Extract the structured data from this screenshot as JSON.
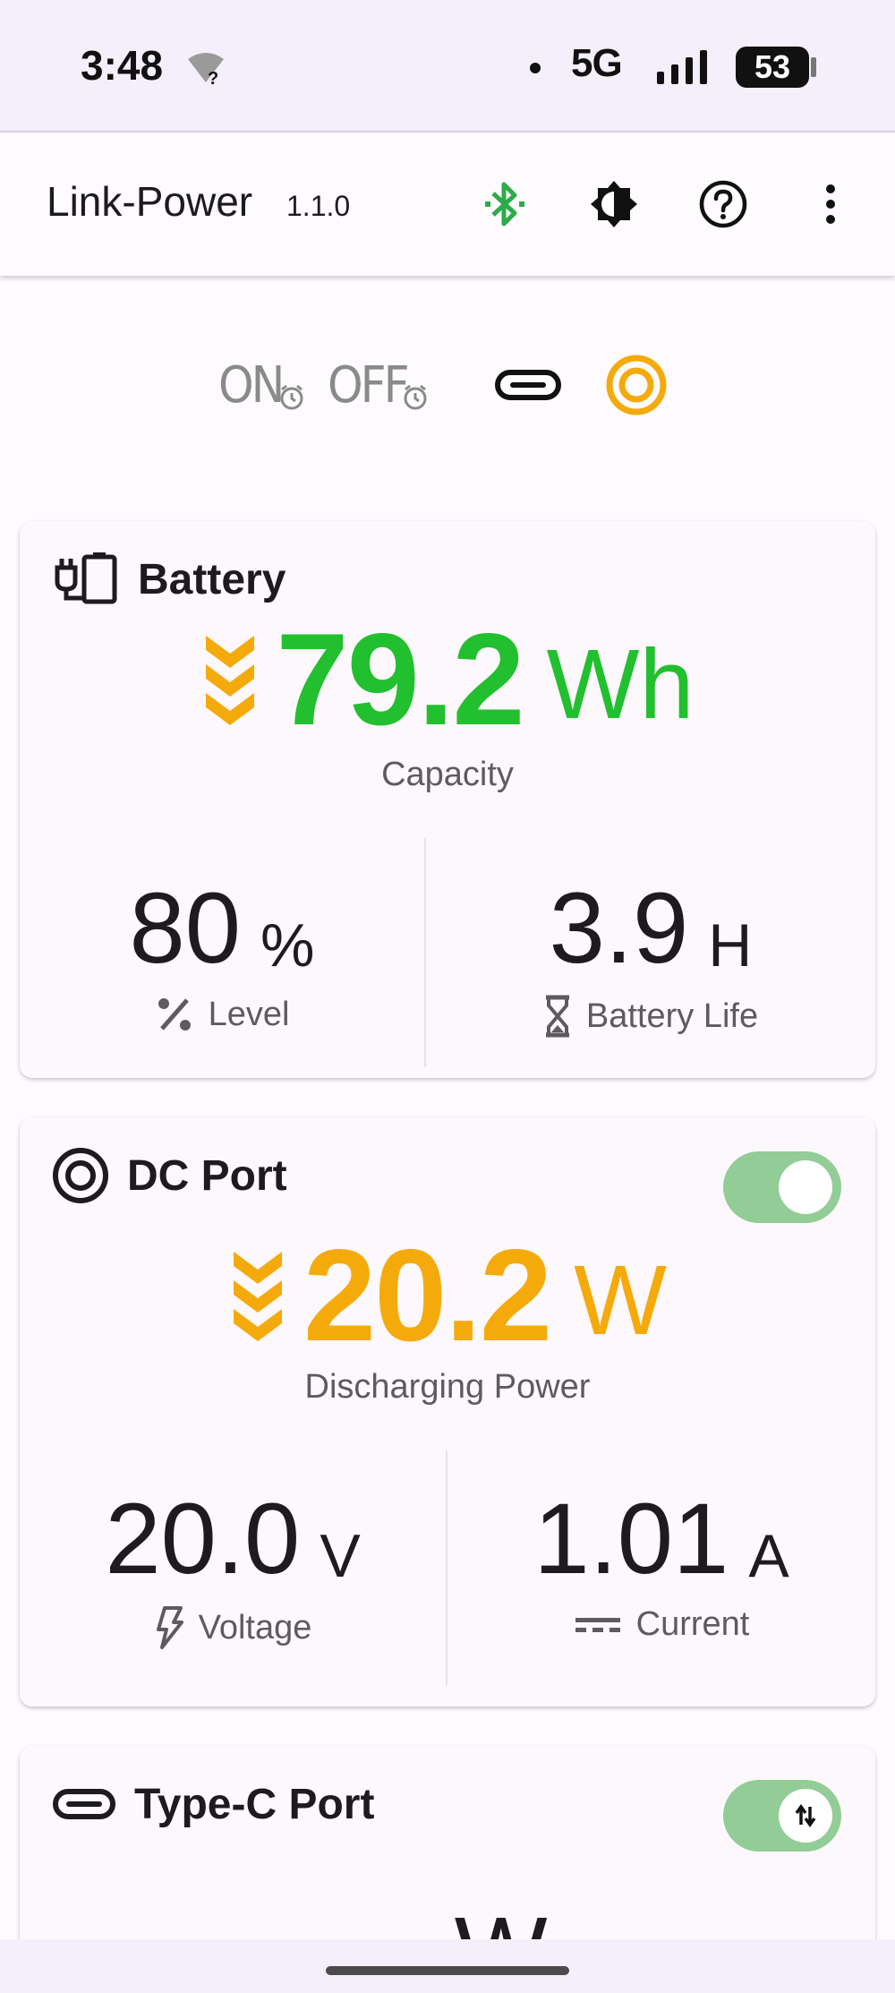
{
  "status_bar": {
    "time": "3:48",
    "network": "5G",
    "battery_percent": "53",
    "icons": [
      "wifi-question-icon",
      "signal-icon",
      "battery-icon"
    ]
  },
  "app_bar": {
    "title": "Link-Power",
    "version": "1.1.0",
    "actions": [
      "bluetooth-icon",
      "brightness-icon",
      "help-icon",
      "more-vert-icon"
    ],
    "bluetooth_color": "#2eab4a"
  },
  "mode_row": {
    "on_timer": "ON",
    "off_timer": "OFF",
    "items": [
      "on-timer-icon",
      "off-timer-icon",
      "usb-c-icon",
      "dc-port-icon"
    ],
    "active_color": "#f5aa0c"
  },
  "battery_card": {
    "title": "Battery",
    "capacity_value": "79.2",
    "capacity_unit": "Wh",
    "capacity_label": "Capacity",
    "capacity_color": "#22c02e",
    "arrow_color": "#f5aa0c",
    "level_value": "80",
    "level_unit": "%",
    "level_label": "Level",
    "life_value": "3.9",
    "life_unit": "H",
    "life_label": "Battery Life"
  },
  "dc_card": {
    "title": "DC Port",
    "toggle_on": true,
    "power_value": "20.2",
    "power_unit": "W",
    "power_label": "Discharging Power",
    "power_color": "#f5aa0c",
    "voltage_value": "20.0",
    "voltage_unit": "V",
    "voltage_label": "Voltage",
    "current_value": "1.01",
    "current_unit": "A",
    "current_label": "Current"
  },
  "typec_card": {
    "title": "Type-C Port",
    "toggle_on": true,
    "power_value": "--",
    "power_unit": "W"
  }
}
